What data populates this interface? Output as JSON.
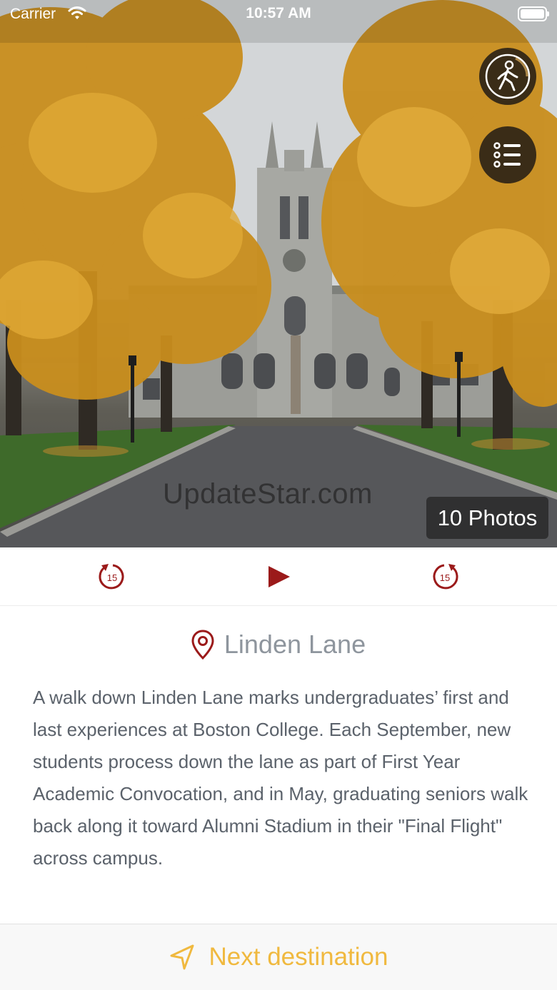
{
  "status_bar": {
    "carrier": "Carrier",
    "time": "10:57 AM"
  },
  "hero": {
    "watermark": "UpdateStar.com",
    "photos_badge": "10 Photos"
  },
  "icons": {
    "walk": "walking-person-icon",
    "list": "list-icon",
    "rewind": "rewind-15-icon",
    "play": "play-icon",
    "forward": "forward-15-icon",
    "pin": "location-pin-icon",
    "navigate": "navigation-arrow-icon"
  },
  "controls": {
    "rewind_seconds": "15",
    "forward_seconds": "15"
  },
  "location": {
    "title": "Linden Lane",
    "description": "A walk down Linden Lane marks undergraduates’ first and last experiences at Boston College. Each September, new students process down the lane as part of First Year Academic Convocation, and in May, graduating seniors walk back along it toward Alumni Stadium in their \"Final Flight\" across campus."
  },
  "footer": {
    "next_label": "Next destination"
  },
  "colors": {
    "accent_red": "#9b1a1a",
    "accent_gold": "#f0b93f",
    "title_gray": "#8e959d",
    "text_gray": "#5b626b"
  }
}
